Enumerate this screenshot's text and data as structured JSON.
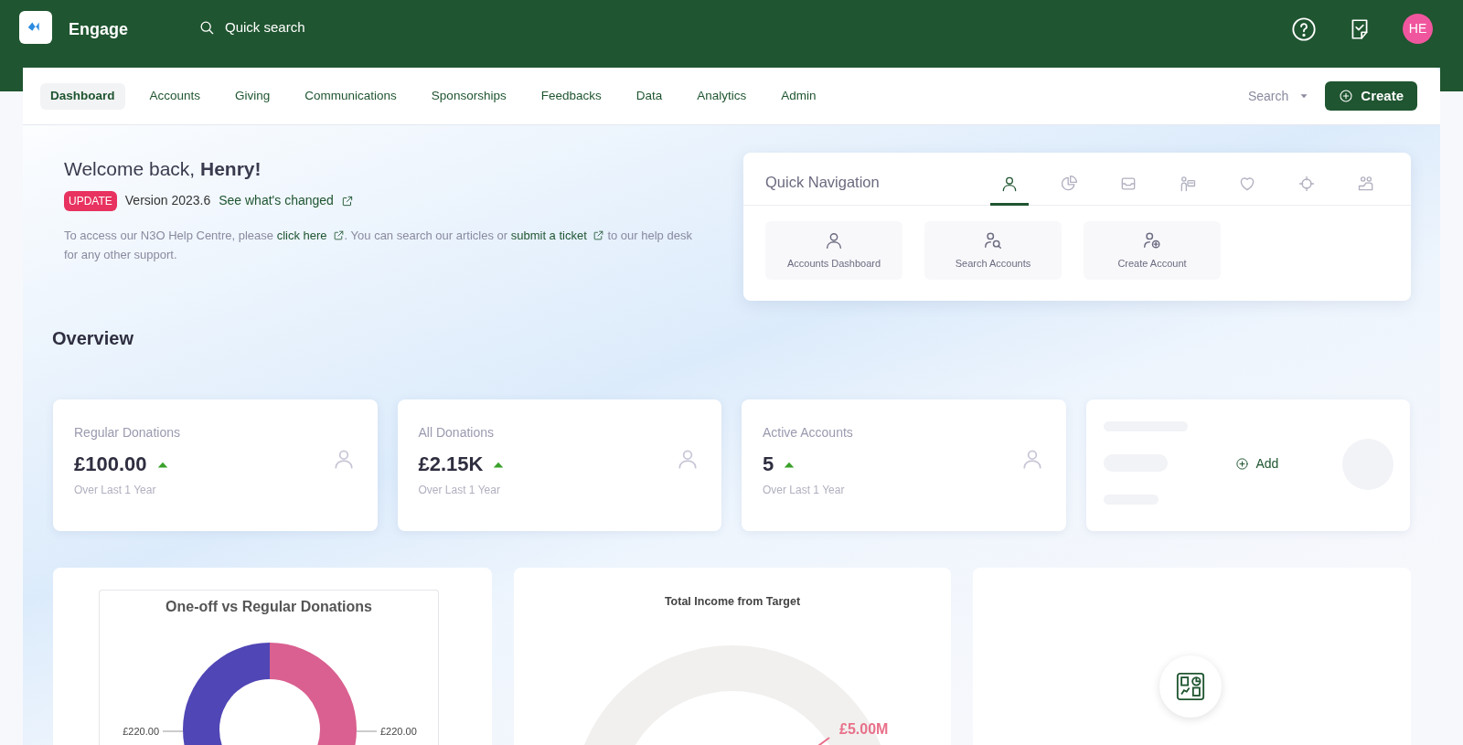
{
  "app": {
    "name": "Engage",
    "search_placeholder": "Quick search",
    "avatar_initials": "HE"
  },
  "nav": {
    "tabs": [
      {
        "label": "Dashboard",
        "selected": true
      },
      {
        "label": "Accounts",
        "selected": false
      },
      {
        "label": "Giving",
        "selected": false
      },
      {
        "label": "Communications",
        "selected": false
      },
      {
        "label": "Sponsorships",
        "selected": false
      },
      {
        "label": "Feedbacks",
        "selected": false
      },
      {
        "label": "Data",
        "selected": false
      },
      {
        "label": "Analytics",
        "selected": false
      },
      {
        "label": "Admin",
        "selected": false
      }
    ],
    "search_label": "Search",
    "create_button": "Create"
  },
  "welcome": {
    "greeting": "Welcome back, **Henry!**",
    "badge": "UPDATE",
    "version": "Version 2023.6",
    "changes_link": "See what's changed",
    "help_parts": [
      "To access our N3O Help Centre, please ",
      "click here",
      ". You can search our articles or ",
      "submit a ticket",
      " to our help desk for any other support."
    ]
  },
  "quick_navigation": {
    "title": "Quick Navigation",
    "tabs": [
      {
        "kind": "person",
        "selected": true
      },
      {
        "kind": "pie",
        "selected": false
      },
      {
        "kind": "inbox",
        "selected": false
      },
      {
        "kind": "speaker",
        "selected": false
      },
      {
        "kind": "heart",
        "selected": false
      },
      {
        "kind": "target",
        "selected": false
      },
      {
        "kind": "people",
        "selected": false
      }
    ],
    "items": [
      {
        "kind": "person",
        "label": "Accounts Dashboard"
      },
      {
        "kind": "search",
        "label": "Search Accounts"
      },
      {
        "kind": "add",
        "label": "Create Account"
      }
    ]
  },
  "overview": {
    "title": "Overview",
    "cards": [
      {
        "kind": "stat",
        "label": "Regular Donations",
        "value": "£100.00",
        "period": "Over Last 1 Year"
      },
      {
        "kind": "stat",
        "label": "All Donations",
        "value": "£2.15K",
        "period": "Over Last 1 Year"
      },
      {
        "kind": "stat",
        "label": "Active Accounts",
        "value": "5",
        "period": "Over Last 1 Year"
      },
      {
        "kind": "add",
        "label": "Add"
      }
    ]
  },
  "donut": {
    "chart_data": {
      "type": "donut",
      "title": "One-off vs Regular Donations",
      "values": [
        220,
        220
      ],
      "value_labels": [
        "£220.00",
        "£220.00"
      ]
    }
  },
  "gauge": {
    "title": "Total Income from Target",
    "target_label": "£5.00M"
  }
}
